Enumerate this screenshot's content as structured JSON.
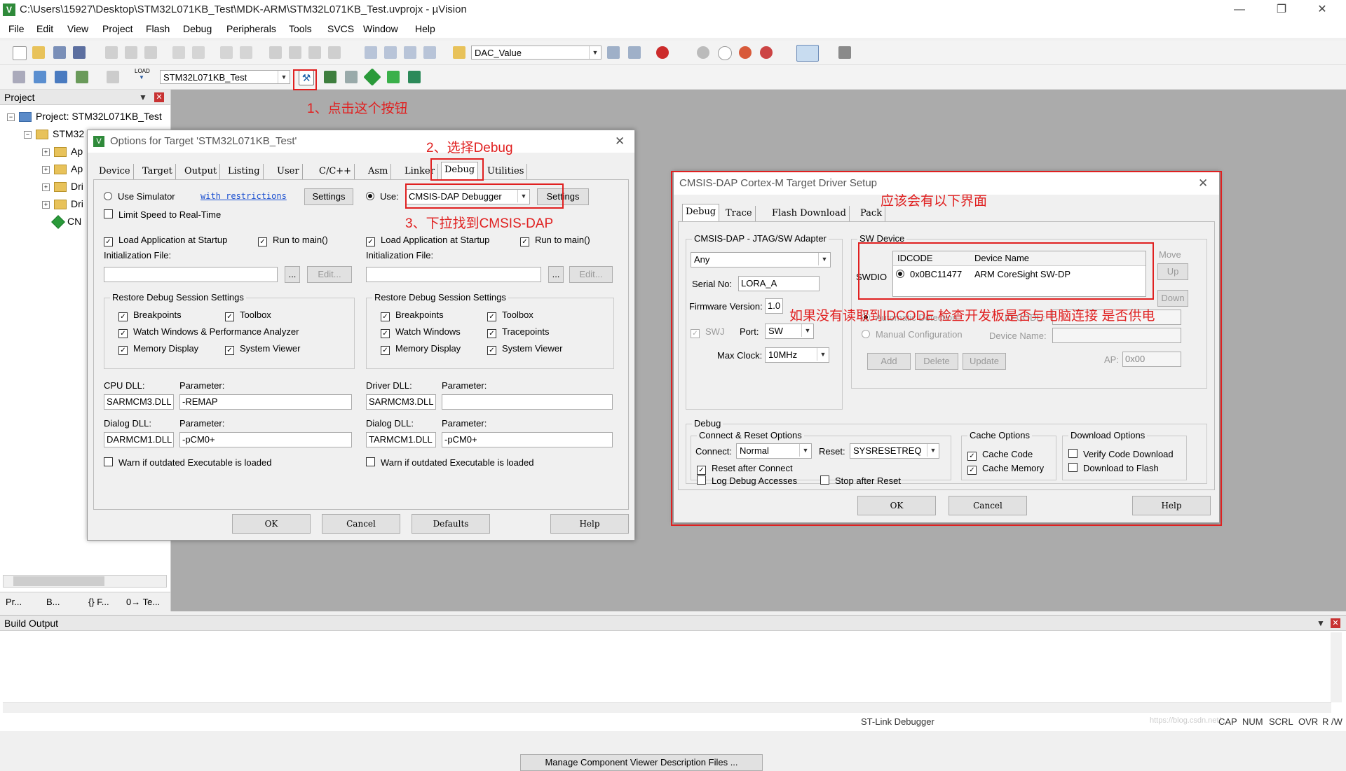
{
  "window": {
    "title": "C:\\Users\\15927\\Desktop\\STM32L071KB_Test\\MDK-ARM\\STM32L071KB_Test.uvprojx - µVision"
  },
  "menu": [
    "File",
    "Edit",
    "View",
    "Project",
    "Flash",
    "Debug",
    "Peripherals",
    "Tools",
    "SVCS",
    "Window",
    "Help"
  ],
  "toolbar": {
    "find_combo": "DAC_Value",
    "target_combo": "STM32L071KB_Test",
    "load_label": "LOAD"
  },
  "project_pane": {
    "header": "Project",
    "root": "Project: STM32L071KB_Test",
    "target": "STM32",
    "items": [
      "Ap",
      "Ap",
      "Dri",
      "Dri",
      "CN"
    ],
    "tabs": [
      "Pr...",
      "B...",
      "{} F...",
      "0→ Te..."
    ]
  },
  "build_output": {
    "header": "Build Output"
  },
  "status": {
    "debugger": "ST-Link Debugger",
    "indicators": [
      "CAP",
      "NUM",
      "SCRL",
      "OVR",
      "R /W"
    ],
    "watermark": "https://blog.csdn.net/..."
  },
  "options_dialog": {
    "title": "Options for Target 'STM32L071KB_Test'",
    "tabs": [
      "Device",
      "Target",
      "Output",
      "Listing",
      "User",
      "C/C++",
      "Asm",
      "Linker",
      "Debug",
      "Utilities"
    ],
    "left": {
      "use_simulator": "Use Simulator",
      "with_restrictions": "with restrictions",
      "settings": "Settings",
      "limit_speed": "Limit Speed to Real-Time",
      "load_app": "Load Application at Startup",
      "run_to_main": "Run to main()",
      "init_file": "Initialization File:",
      "browse": "...",
      "edit": "Edit...",
      "restore_group": "Restore Debug Session Settings",
      "breakpoints": "Breakpoints",
      "toolbox": "Toolbox",
      "watch": "Watch Windows & Performance Analyzer",
      "memory": "Memory Display",
      "system_viewer": "System Viewer",
      "dll_label": "CPU DLL:",
      "param_label": "Parameter:",
      "dll": "SARMCM3.DLL",
      "dll_param": "-REMAP",
      "dialog_dll_label": "Dialog DLL:",
      "dialog_dll": "DARMCM1.DLL",
      "dialog_param": "-pCM0+",
      "warn": "Warn if outdated Executable is loaded"
    },
    "right": {
      "use": "Use:",
      "debugger": "CMSIS-DAP Debugger",
      "settings": "Settings",
      "load_app": "Load Application at Startup",
      "run_to_main": "Run to main()",
      "init_file": "Initialization File:",
      "browse": "...",
      "edit": "Edit...",
      "restore_group": "Restore Debug Session Settings",
      "breakpoints": "Breakpoints",
      "toolbox": "Toolbox",
      "watch": "Watch Windows",
      "tracepoints": "Tracepoints",
      "memory": "Memory Display",
      "system_viewer": "System Viewer",
      "dll_label": "Driver DLL:",
      "param_label": "Parameter:",
      "dll": "SARMCM3.DLL",
      "dll_param": "",
      "dialog_dll_label": "Dialog DLL:",
      "dialog_dll": "TARMCM1.DLL",
      "dialog_param": "-pCM0+",
      "warn": "Warn if outdated Executable is loaded"
    },
    "manage_btn": "Manage Component Viewer Description Files ...",
    "ok": "OK",
    "cancel": "Cancel",
    "defaults": "Defaults",
    "help": "Help"
  },
  "cmsis_dialog": {
    "title": "CMSIS-DAP Cortex-M Target Driver Setup",
    "tabs": [
      "Debug",
      "Trace",
      "Flash Download",
      "Pack"
    ],
    "adapter_group": "CMSIS-DAP - JTAG/SW Adapter",
    "adapter": "Any",
    "serial_label": "Serial No:",
    "serial": "LORA_A",
    "fw_label": "Firmware Version:",
    "fw": "1.0",
    "swj": "SWJ",
    "port_label": "Port:",
    "port": "SW",
    "clock_label": "Max Clock:",
    "clock": "10MHz",
    "sw_group": "SW Device",
    "swdio": "SWDIO",
    "col_idcode": "IDCODE",
    "col_device": "Device Name",
    "idcode": "0x0BC11477",
    "device": "ARM CoreSight SW-DP",
    "move": "Move",
    "up": "Up",
    "down": "Down",
    "auto_detect": "Automatic Detection",
    "manual_config": "Manual Configuration",
    "idcode_label": "ID CODE:",
    "device_name_label": "Device Name:",
    "ap_label": "AP:",
    "ap": "0x00",
    "add": "Add",
    "delete": "Delete",
    "update": "Update",
    "debug_group": "Debug",
    "connect_group": "Connect & Reset Options",
    "connect_label": "Connect:",
    "connect": "Normal",
    "reset_label": "Reset:",
    "reset": "SYSRESETREQ",
    "reset_after": "Reset after Connect",
    "log_access": "Log Debug Accesses",
    "stop_after": "Stop after Reset",
    "cache_group": "Cache Options",
    "cache_code": "Cache Code",
    "cache_memory": "Cache Memory",
    "download_group": "Download Options",
    "verify": "Verify Code Download",
    "download_flash": "Download to Flash",
    "ok": "OK",
    "cancel": "Cancel",
    "help": "Help"
  },
  "annotations": {
    "step1": "1、点击这个按钮",
    "step2": "2、选择Debug",
    "step3": "3、下拉找到CMSIS-DAP",
    "expected": "应该会有以下界面",
    "warning": "如果没有读取到IDCODE 检查开发板是否与电脑连接 是否供电"
  },
  "colors": {
    "annotation": "#e02020",
    "workspace": "#ababab"
  }
}
